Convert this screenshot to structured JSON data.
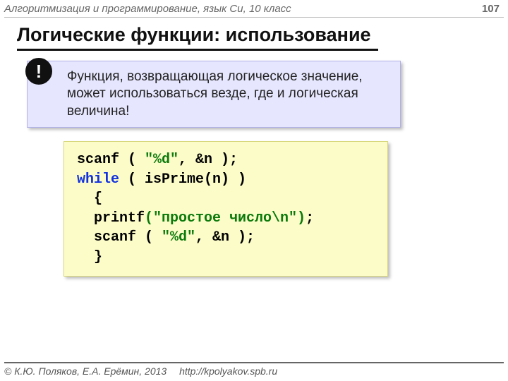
{
  "header": {
    "subject": "Алгоритмизация и программирование, язык Си, 10 класс"
  },
  "page_number": "107",
  "title": "Логические функции: использование",
  "info": {
    "icon": "!",
    "text": "Функция, возвращающая логическое значение, может использоваться везде, где и логическая величина!"
  },
  "code": {
    "l1a": "scanf ( ",
    "l1b": "\"%d\"",
    "l1c": ", &n );",
    "l2a": "while",
    "l2b": " ( isPrime(n) )",
    "l3": "  {",
    "l4a": "  printf",
    "l4b": "(\"простое число\\n\")",
    "l4c": ";",
    "l5a": "  scanf ( ",
    "l5b": "\"%d\"",
    "l5c": ", &n );",
    "l6": "  }"
  },
  "footer": {
    "copyright": "© К.Ю. Поляков, Е.А. Ерёмин, 2013",
    "url": "http://kpolyakov.spb.ru"
  }
}
